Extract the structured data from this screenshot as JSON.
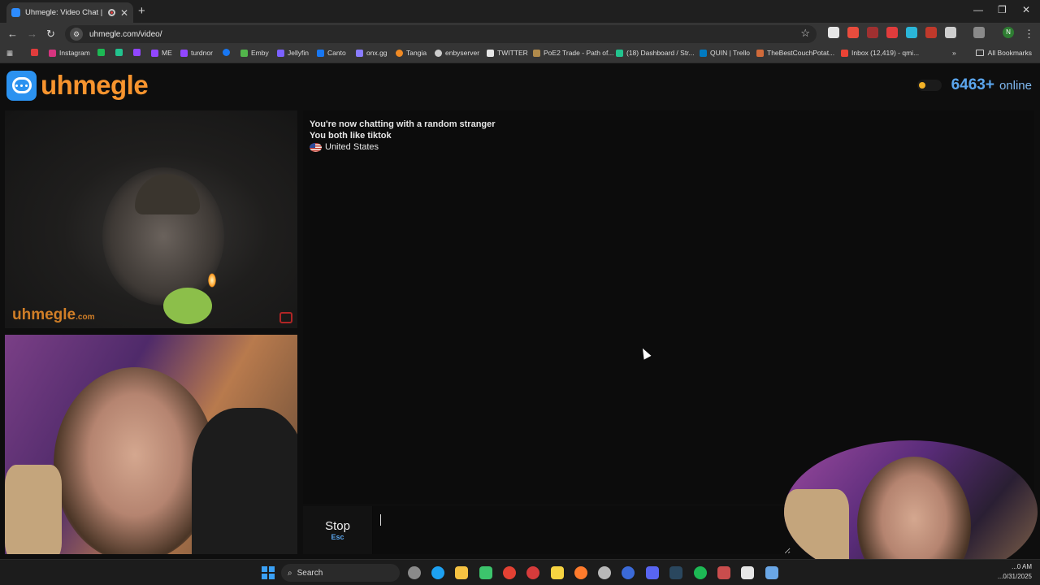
{
  "browser": {
    "tab_title": "Uhmegle: Video Chat | Ran",
    "tab_close": "✕",
    "new_tab": "+",
    "url": "uhmegle.com/video/",
    "window_controls": [
      "—",
      "❐",
      "✕"
    ],
    "bookmarks": [
      {
        "label": "Instagram",
        "color": "#d6347f"
      },
      {
        "label": "",
        "color": "#1db954"
      },
      {
        "label": "",
        "color": "#22c38e"
      },
      {
        "label": "",
        "color": "#9146ff"
      },
      {
        "label": "ME",
        "color": "#9146ff"
      },
      {
        "label": "turdnor",
        "color": "#9146ff"
      },
      {
        "label": "",
        "color": "#1877f2"
      },
      {
        "label": "Emby",
        "color": "#52b54b"
      },
      {
        "label": "Jellyfin",
        "color": "#7b61ff"
      },
      {
        "label": "Canto",
        "color": "#1877f2"
      },
      {
        "label": "onx.gg",
        "color": "#8a7cff"
      },
      {
        "label": "Tangia",
        "color": "#f08a24"
      },
      {
        "label": "enbyserver",
        "color": "#cccccc"
      },
      {
        "label": "TWITTER",
        "color": "#e6e6e6"
      },
      {
        "label": "PoE2 Trade - Path of...",
        "color": "#b08a4b"
      },
      {
        "label": "(18) Dashboard / Str...",
        "color": "#22c38e"
      },
      {
        "label": "QUIN | Trello",
        "color": "#0079bf"
      },
      {
        "label": "TheBestCouchPotat...",
        "color": "#d06a3a"
      },
      {
        "label": "Inbox (12,419) - qmi...",
        "color": "#ea4335"
      }
    ],
    "all_bookmarks": "All Bookmarks",
    "profile_initial": "N"
  },
  "site": {
    "brand": "uhmegle",
    "online_count": "6463+",
    "online_label": "online",
    "watermark": "uhmegle",
    "watermark_suffix": ".com"
  },
  "chat": {
    "lines": [
      "You're now chatting with a random stranger",
      "You both like tiktok"
    ],
    "country": "United States"
  },
  "controls": {
    "stop_label": "Stop",
    "stop_key": "Esc",
    "message_value": ""
  },
  "taskbar": {
    "search_label": "Search",
    "time": "...0 AM",
    "date": "...0/31/2025"
  }
}
